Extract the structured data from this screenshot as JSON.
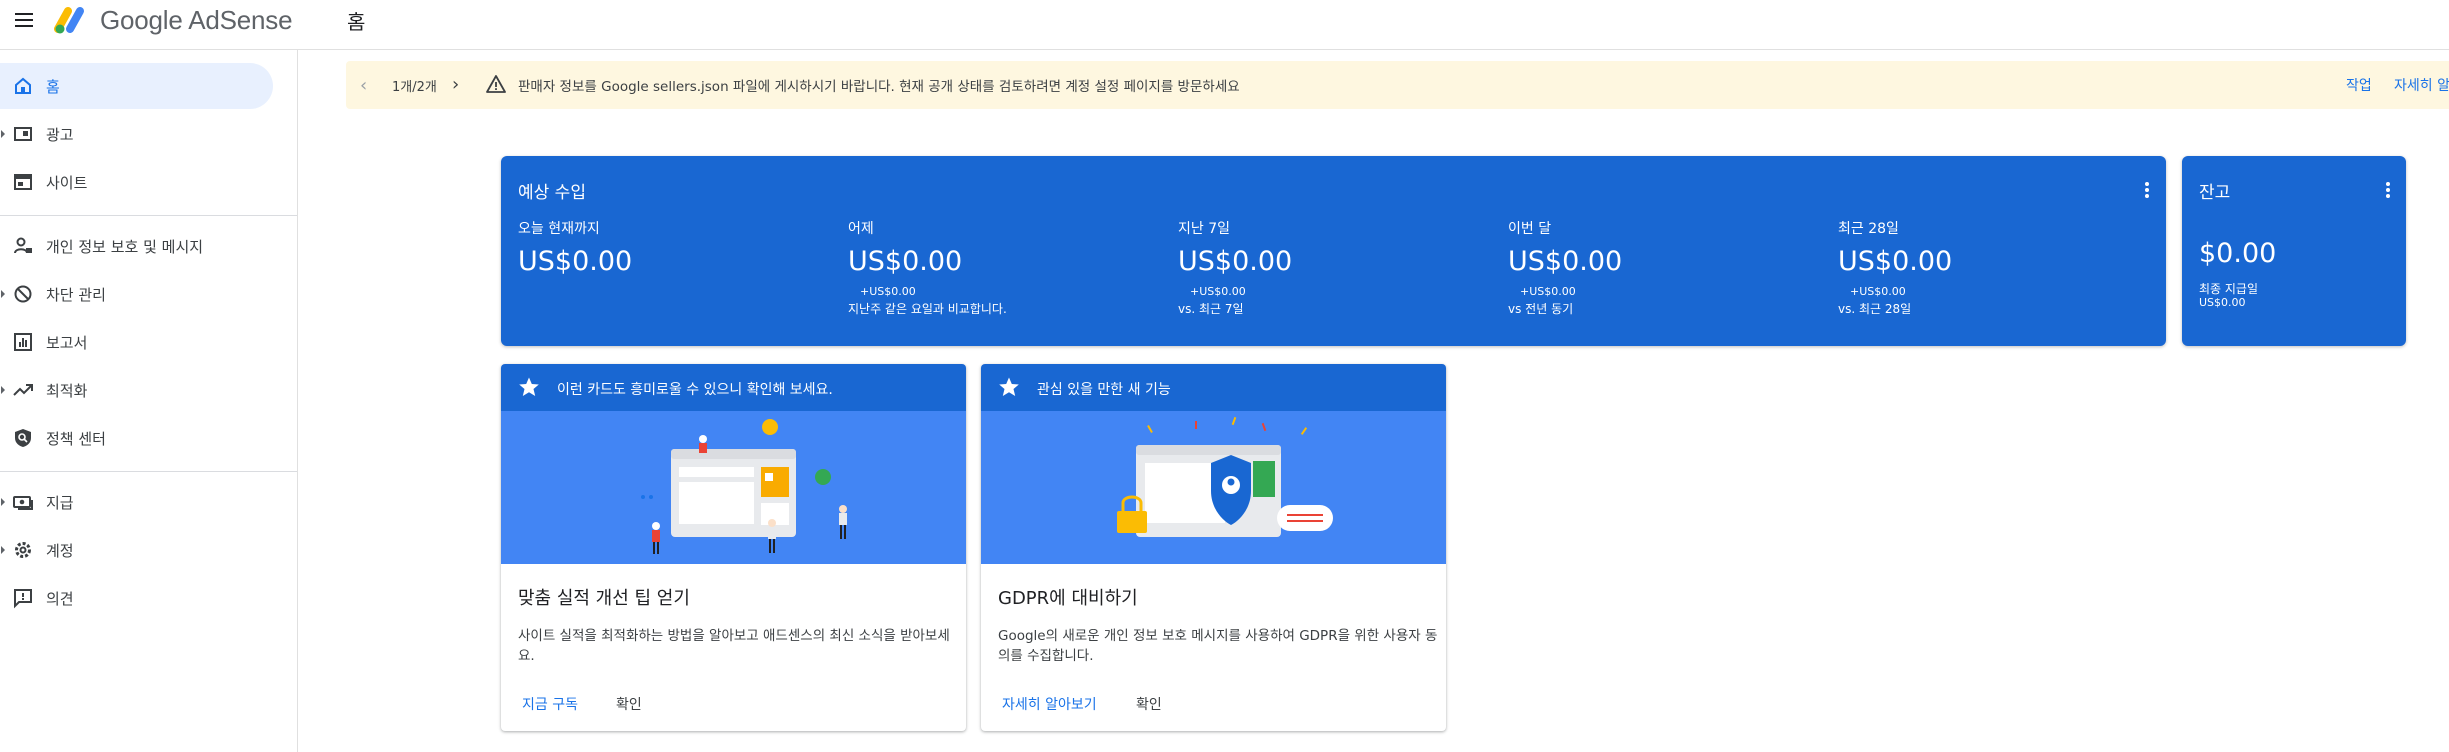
{
  "app": {
    "brand": "Google AdSense",
    "page_title": "홈"
  },
  "sidebar": {
    "items": [
      {
        "label": "홈",
        "icon": "home-icon",
        "active": true,
        "expandable": false
      },
      {
        "label": "광고",
        "icon": "ads-icon",
        "active": false,
        "expandable": true
      },
      {
        "label": "사이트",
        "icon": "sites-icon",
        "active": false,
        "expandable": false
      },
      {
        "label": "개인 정보 보호 및 메시지",
        "icon": "privacy-icon",
        "active": false,
        "expandable": false
      },
      {
        "label": "차단 관리",
        "icon": "block-icon",
        "active": false,
        "expandable": true
      },
      {
        "label": "보고서",
        "icon": "reports-icon",
        "active": false,
        "expandable": false
      },
      {
        "label": "최적화",
        "icon": "optimize-icon",
        "active": false,
        "expandable": true
      },
      {
        "label": "정책 센터",
        "icon": "policy-icon",
        "active": false,
        "expandable": false
      },
      {
        "label": "지급",
        "icon": "payments-icon",
        "active": false,
        "expandable": true
      },
      {
        "label": "계정",
        "icon": "account-gear-icon",
        "active": false,
        "expandable": true
      },
      {
        "label": "의견",
        "icon": "feedback-icon",
        "active": false,
        "expandable": false
      }
    ]
  },
  "banner": {
    "pager": "1개/2개",
    "message": "판매자 정보를 Google sellers.json 파일에 게시하시기 바랍니다. 현재 공개 상태를 검토하려면 계정 설정 페이지를 방문하세요",
    "action_label": "작업",
    "learn_more_label": "자세히 알아보기"
  },
  "earnings": {
    "title": "예상 수입",
    "metrics": [
      {
        "label": "오늘 현재까지",
        "value": "US$0.00",
        "delta": "",
        "compare": ""
      },
      {
        "label": "어제",
        "value": "US$0.00",
        "delta": "+US$0.00",
        "compare": "지난주 같은 요일과 비교합니다."
      },
      {
        "label": "지난 7일",
        "value": "US$0.00",
        "delta": "+US$0.00",
        "compare": "vs. 최근 7일"
      },
      {
        "label": "이번 달",
        "value": "US$0.00",
        "delta": "+US$0.00",
        "compare": "vs 전년 동기"
      },
      {
        "label": "최근 28일",
        "value": "US$0.00",
        "delta": "+US$0.00",
        "compare": "vs. 최근 28일"
      }
    ]
  },
  "balance": {
    "title": "잔고",
    "value": "$0.00",
    "last_payment_label": "최종 지급일",
    "last_payment_value": "US$0.00"
  },
  "cards": [
    {
      "header": "이런 카드도 흥미로울 수 있으니 확인해 보세요.",
      "title": "맞춤 실적 개선 팁 얻기",
      "body": "사이트 실적을 최적화하는 방법을 알아보고 애드센스의 최신 소식을 받아보세요.",
      "primary": "지금 구독",
      "secondary": "확인"
    },
    {
      "header": "관심 있을 만한 새 기능",
      "title": "GDPR에 대비하기",
      "body": "Google의 새로운 개인 정보 보호 메시지를 사용하여 GDPR을 위한 사용자 동의를 수집합니다.",
      "primary": "자세히 알아보기",
      "secondary": "확인"
    }
  ],
  "colors": {
    "brand_blue": "#1967d2",
    "link_blue": "#1a73e8",
    "banner_bg": "#fef7e0",
    "active_nav_bg": "#e8f0fe"
  }
}
